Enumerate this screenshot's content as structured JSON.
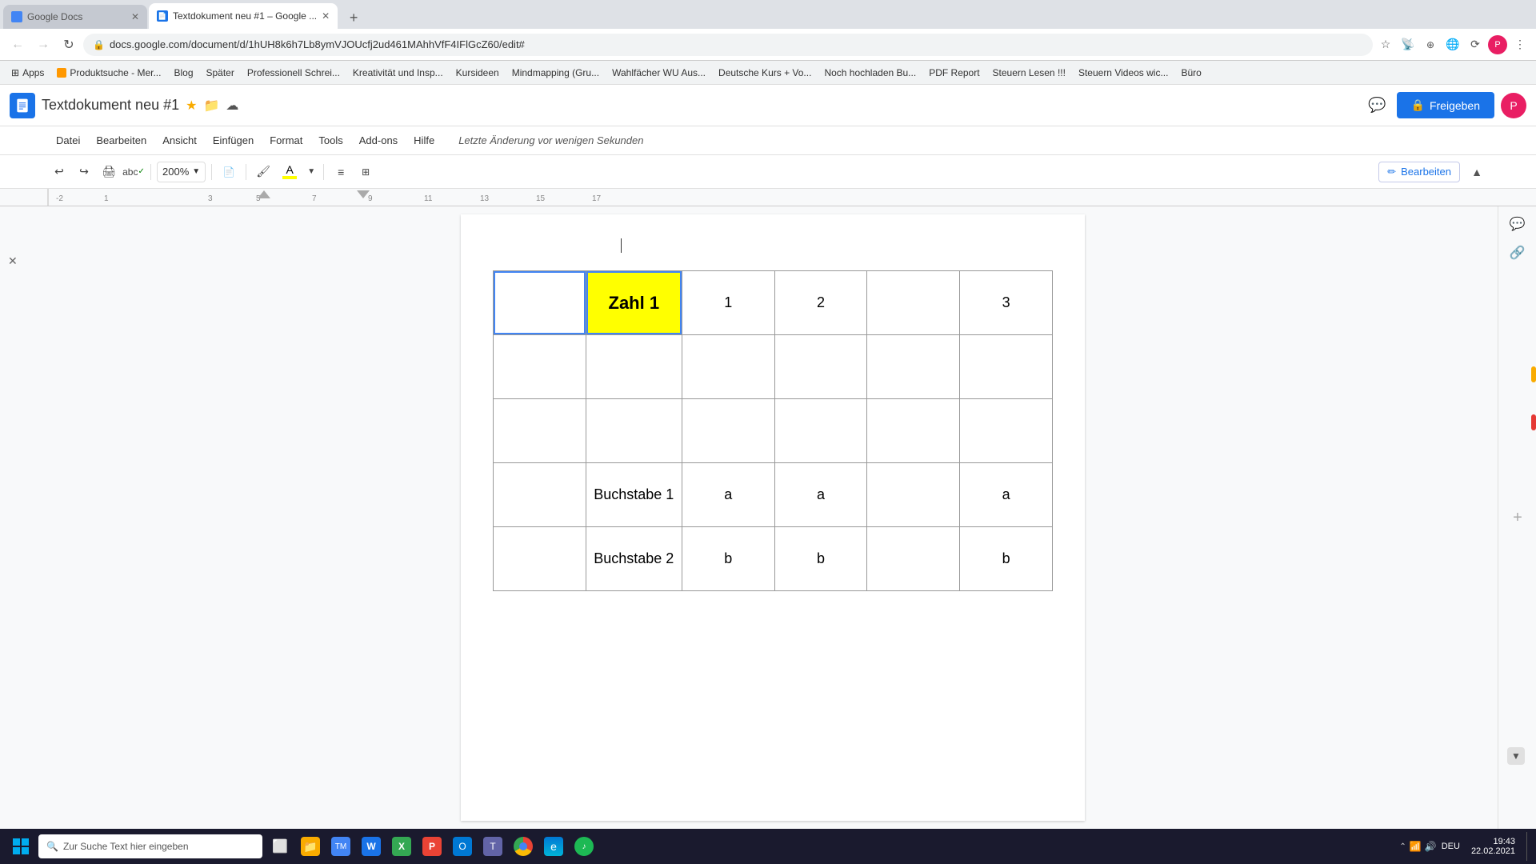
{
  "browser": {
    "tabs": [
      {
        "id": "tab1",
        "title": "Google Docs",
        "url": "",
        "active": false,
        "favicon_color": "#4285f4"
      },
      {
        "id": "tab2",
        "title": "Textdokument neu #1 – Google ...",
        "url": "docs.google.com/document/d/1hUH8k6h7Lb8ymVJOUcfj2ud461MAhhVfF4IFlGcZ60/edit#",
        "active": true,
        "favicon_color": "#1a73e8"
      }
    ],
    "bookmarks": [
      {
        "label": "Apps"
      },
      {
        "label": "Produktsuche - Mer..."
      },
      {
        "label": "Blog"
      },
      {
        "label": "Später"
      },
      {
        "label": "Professionell Schrei..."
      },
      {
        "label": "Kreativität und Insp..."
      },
      {
        "label": "Kursideen"
      },
      {
        "label": "Mindmapping  (Gru..."
      },
      {
        "label": "Wahlfächer WU Aus..."
      },
      {
        "label": "Deutsche Kurs + Vo..."
      },
      {
        "label": "Noch hochladen Bu..."
      },
      {
        "label": "PDF Report"
      },
      {
        "label": "Steuern Lesen !!!"
      },
      {
        "label": "Steuern Videos wic..."
      },
      {
        "label": "Büro"
      }
    ]
  },
  "docs": {
    "title": "Textdokument neu #1",
    "last_saved": "Letzte Änderung vor wenigen Sekunden",
    "zoom": "200%",
    "share_label": "Freigeben",
    "edit_label": "Bearbeiten",
    "menu": {
      "items": [
        "Datei",
        "Bearbeiten",
        "Ansicht",
        "Einfügen",
        "Format",
        "Tools",
        "Add-ons",
        "Hilfe"
      ]
    },
    "toolbar": {
      "undo_label": "↩",
      "redo_label": "↪",
      "print_label": "🖨",
      "spellcheck_label": "✓",
      "paint_format_label": "🖌"
    }
  },
  "table": {
    "rows": [
      [
        "",
        "Zahl 1",
        "1",
        "2",
        "",
        "3"
      ],
      [
        "",
        "",
        "",
        "",
        "",
        ""
      ],
      [
        "",
        "",
        "",
        "",
        "",
        ""
      ],
      [
        "",
        "Buchstabe 1",
        "a",
        "a",
        "",
        "a"
      ],
      [
        "",
        "Buchstabe 2",
        "b",
        "b",
        "",
        "b"
      ]
    ],
    "header_cell_text": "Zahl 1",
    "buchstabe1": "Buchstabe 1",
    "buchstabe2": "Buchstabe 2"
  },
  "taskbar": {
    "search_placeholder": "Zur Suche Text hier eingeben",
    "time": "19:43",
    "date": "22.02.2021",
    "language": "DEU"
  }
}
